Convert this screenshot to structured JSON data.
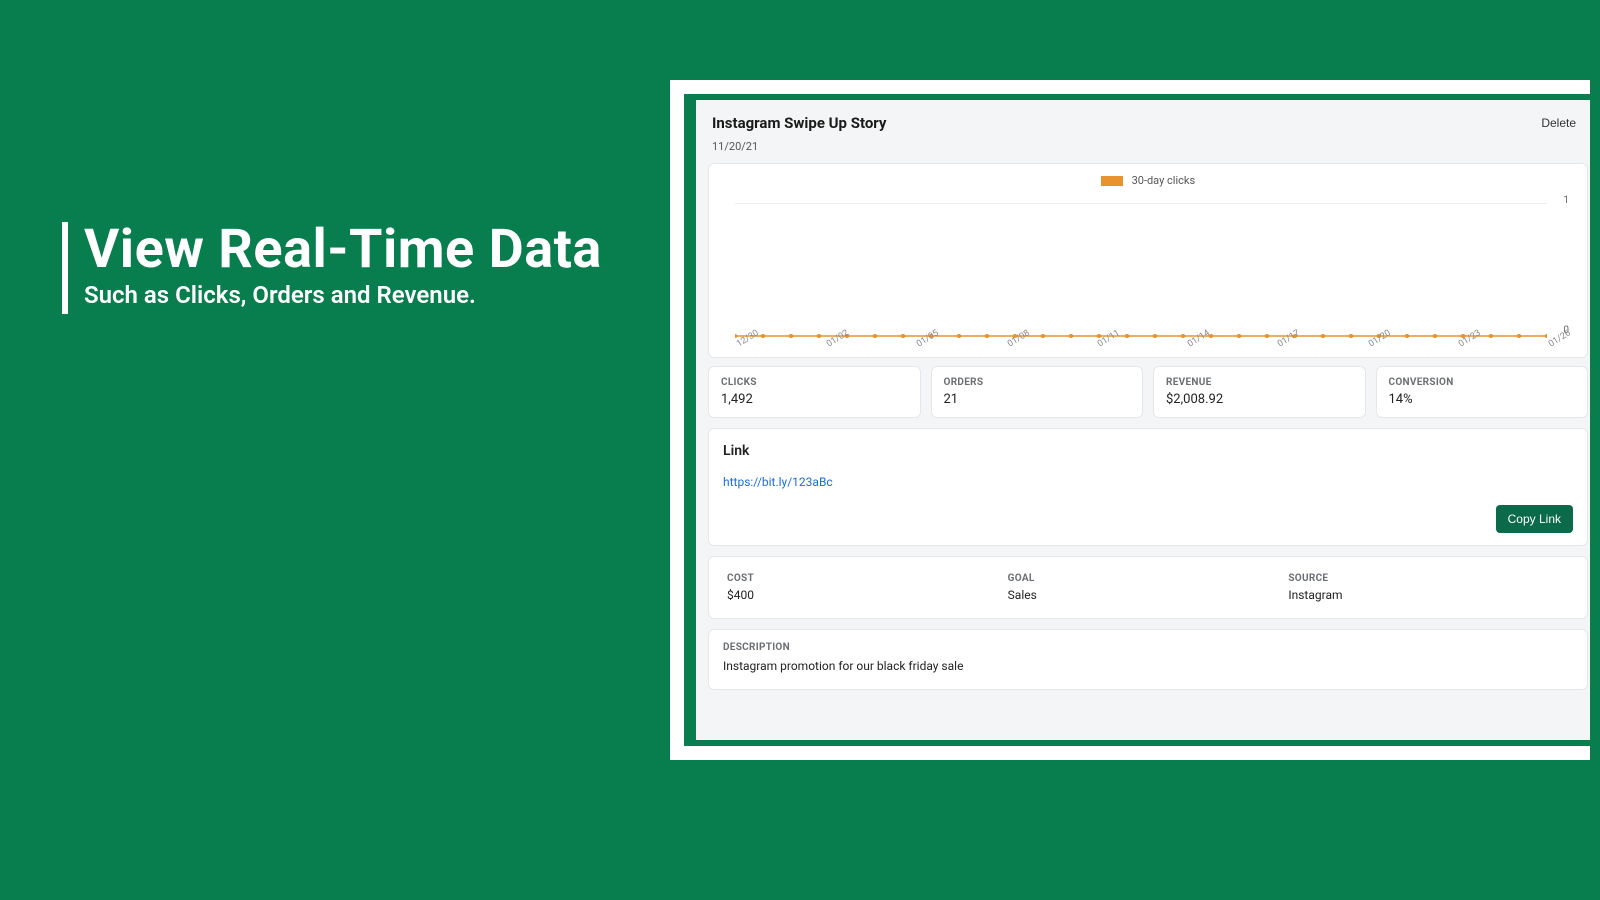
{
  "hero": {
    "title": "View Real-Time Data",
    "subtitle": "Such as Clicks, Orders and Revenue."
  },
  "app": {
    "title": "Instagram Swipe Up Story",
    "delete_label": "Delete",
    "date": "11/20/21"
  },
  "chart_data": {
    "type": "line",
    "series_name": "30-day clicks",
    "ylim": [
      0,
      1
    ],
    "y_ticks": {
      "top": "1",
      "bottom": "0"
    },
    "x_tick_labels": [
      "12/30",
      "01/02",
      "01/05",
      "01/08",
      "01/11",
      "01/14",
      "01/17",
      "01/20",
      "01/23",
      "01/26"
    ],
    "x": [
      "12/30",
      "12/31",
      "01/01",
      "01/02",
      "01/03",
      "01/04",
      "01/05",
      "01/06",
      "01/07",
      "01/08",
      "01/09",
      "01/10",
      "01/11",
      "01/12",
      "01/13",
      "01/14",
      "01/15",
      "01/16",
      "01/17",
      "01/18",
      "01/19",
      "01/20",
      "01/21",
      "01/22",
      "01/23",
      "01/24",
      "01/25",
      "01/26",
      "01/27",
      "01/28"
    ],
    "values": [
      0,
      0,
      0,
      0,
      0,
      0,
      0,
      0,
      0,
      0,
      0,
      0,
      0,
      0,
      0,
      0,
      0,
      0,
      0,
      0,
      0,
      0,
      0,
      0,
      0,
      0,
      0,
      0,
      0,
      0
    ]
  },
  "stats": {
    "clicks": {
      "label": "CLICKS",
      "value": "1,492"
    },
    "orders": {
      "label": "ORDERS",
      "value": "21"
    },
    "revenue": {
      "label": "REVENUE",
      "value": "$2,008.92"
    },
    "conversion": {
      "label": "CONVERSION",
      "value": "14%"
    }
  },
  "link": {
    "title": "Link",
    "url": "https://bit.ly/123aBc",
    "copy_label": "Copy Link"
  },
  "meta": {
    "cost": {
      "label": "COST",
      "value": "$400"
    },
    "goal": {
      "label": "GOAL",
      "value": "Sales"
    },
    "source": {
      "label": "SOURCE",
      "value": "Instagram"
    }
  },
  "description": {
    "label": "DESCRIPTION",
    "value": "Instagram promotion for our black friday sale"
  }
}
